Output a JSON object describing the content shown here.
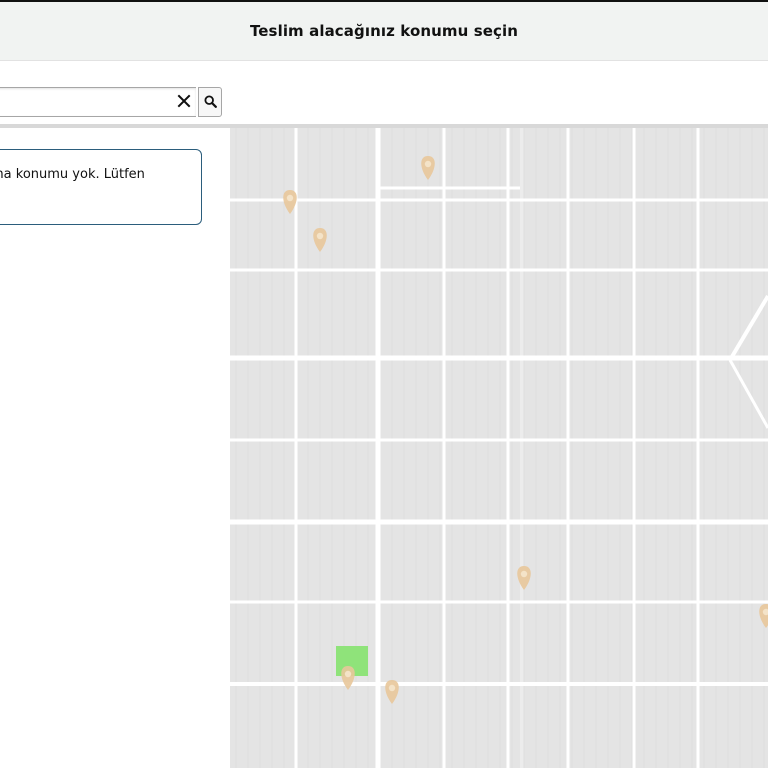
{
  "header": {
    "title": "Teslim alacağınız konumu seçin"
  },
  "search": {
    "value": "",
    "placeholder": "",
    "clear_icon": "close-icon",
    "search_icon": "search-icon"
  },
  "notice": {
    "text": "ma konumu yok. Lütfen"
  },
  "map": {
    "pin_color": "#e8c79a",
    "road_color": "#ffffff",
    "block_color": "#e4e4e4",
    "highlight_color": "#8fe37a",
    "pin_count": 9
  }
}
